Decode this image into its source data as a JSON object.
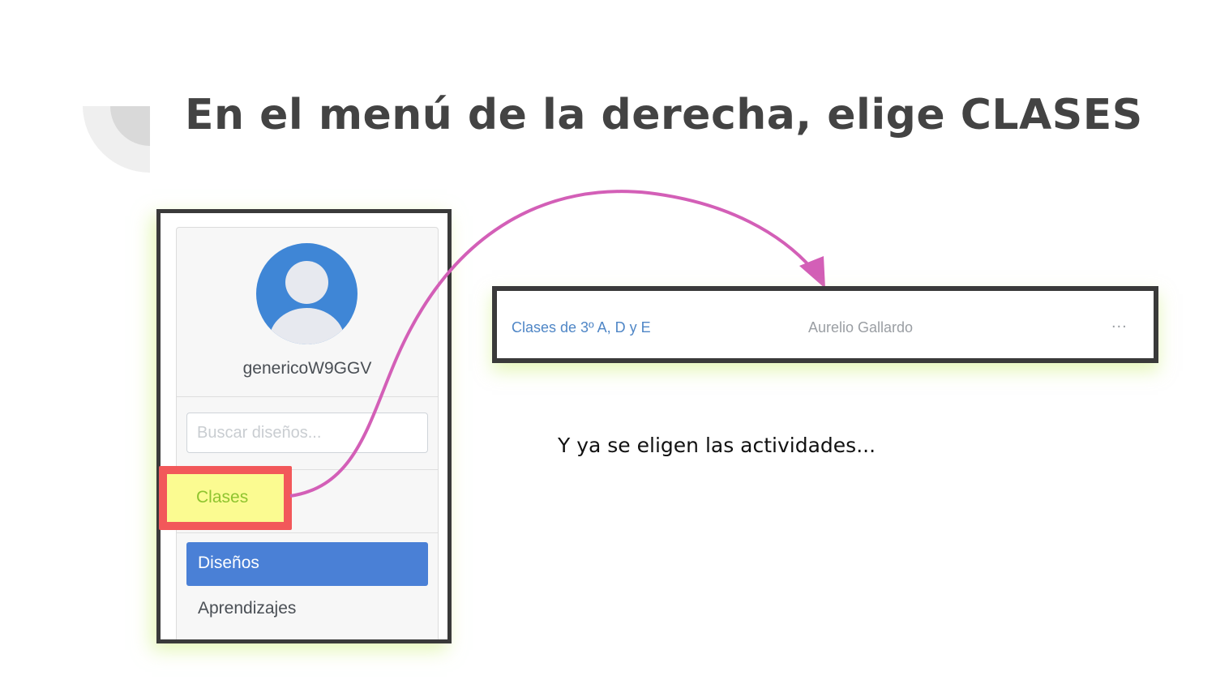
{
  "slide": {
    "title": "En el menú de la derecha, elige CLASES",
    "note": "Y ya se eligen las actividades..."
  },
  "sidebar": {
    "username": "genericoW9GGV",
    "search_placeholder": "Buscar diseños...",
    "items": [
      {
        "label": "Clases",
        "state": "highlighted"
      },
      {
        "label": "Diseños",
        "state": "active"
      },
      {
        "label": "Aprendizajes",
        "state": "default"
      }
    ]
  },
  "class_row": {
    "class_name": "Clases de 3º A, D y E",
    "teacher": "Aurelio Gallardo",
    "more": "..."
  },
  "colors": {
    "title": "#434343",
    "highlight_fill": "#fbfb91",
    "highlight_border": "#f2585a",
    "arrow": "#d35fb7",
    "active_nav": "#4a80d6",
    "avatar": "#3f86d6",
    "link": "#4f86c6"
  },
  "icons": {
    "avatar": "user-avatar-icon",
    "more": "more-options-icon",
    "arrow": "curved-arrow-icon"
  }
}
